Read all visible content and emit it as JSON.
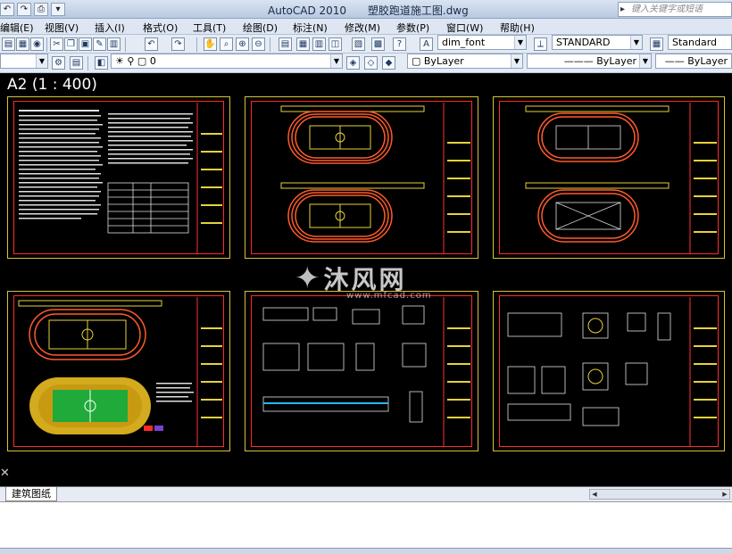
{
  "window": {
    "app_title": "AutoCAD 2010",
    "file_title": "塑胶跑道施工图.dwg",
    "search_placeholder": "键入关键字或短语"
  },
  "menu": {
    "items": [
      "编辑(E)",
      "视图(V)",
      "插入(I)",
      "格式(O)",
      "工具(T)",
      "绘图(D)",
      "标注(N)",
      "修改(M)",
      "参数(P)",
      "窗口(W)",
      "帮助(H)"
    ]
  },
  "toolbar": {
    "text_style": "dim_font",
    "dim_style": "STANDARD",
    "table_style": "Standard",
    "layer_value": "0",
    "color_value": "ByLayer",
    "linetype_value": "ByLayer",
    "lineweight_value": "ByLayer"
  },
  "canvas": {
    "scale_label": "A2 (1 : 400)",
    "background": "#000000",
    "sheet_border_color": "#d9c23a",
    "sheet_inner_color": "#ff2a2a"
  },
  "watermark": {
    "brand_text": "沐风网",
    "url_text": "www.mfcad.com"
  },
  "layout_tabs": {
    "active_tab": "建筑图纸"
  }
}
